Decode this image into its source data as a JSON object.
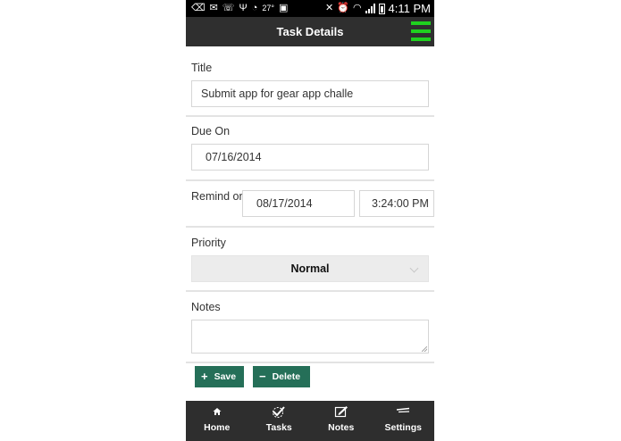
{
  "status_bar": {
    "temperature": "27°",
    "time": "4:11 PM"
  },
  "header": {
    "title": "Task Details"
  },
  "form": {
    "title_label": "Title",
    "title_value": "Submit app for gear app challe",
    "due_label": "Due On",
    "due_value": "07/16/2014",
    "remind_label": "Remind on",
    "remind_date": "08/17/2014",
    "remind_time": "3:24:00 PM",
    "priority_label": "Priority",
    "priority_value": "Normal",
    "notes_label": "Notes",
    "notes_value": ""
  },
  "actions": {
    "save_label": "Save",
    "delete_label": "Delete"
  },
  "nav": {
    "items": [
      {
        "label": "Home",
        "icon": "home-icon"
      },
      {
        "label": "Tasks",
        "icon": "tasks-icon"
      },
      {
        "label": "Notes",
        "icon": "notes-icon"
      },
      {
        "label": "Settings",
        "icon": "settings-icon"
      }
    ]
  },
  "colors": {
    "header_bg": "#2f2f2f",
    "menu_accent": "#1fd11f",
    "button_bg": "#256f58",
    "nav_bg": "#2e2e2e"
  }
}
